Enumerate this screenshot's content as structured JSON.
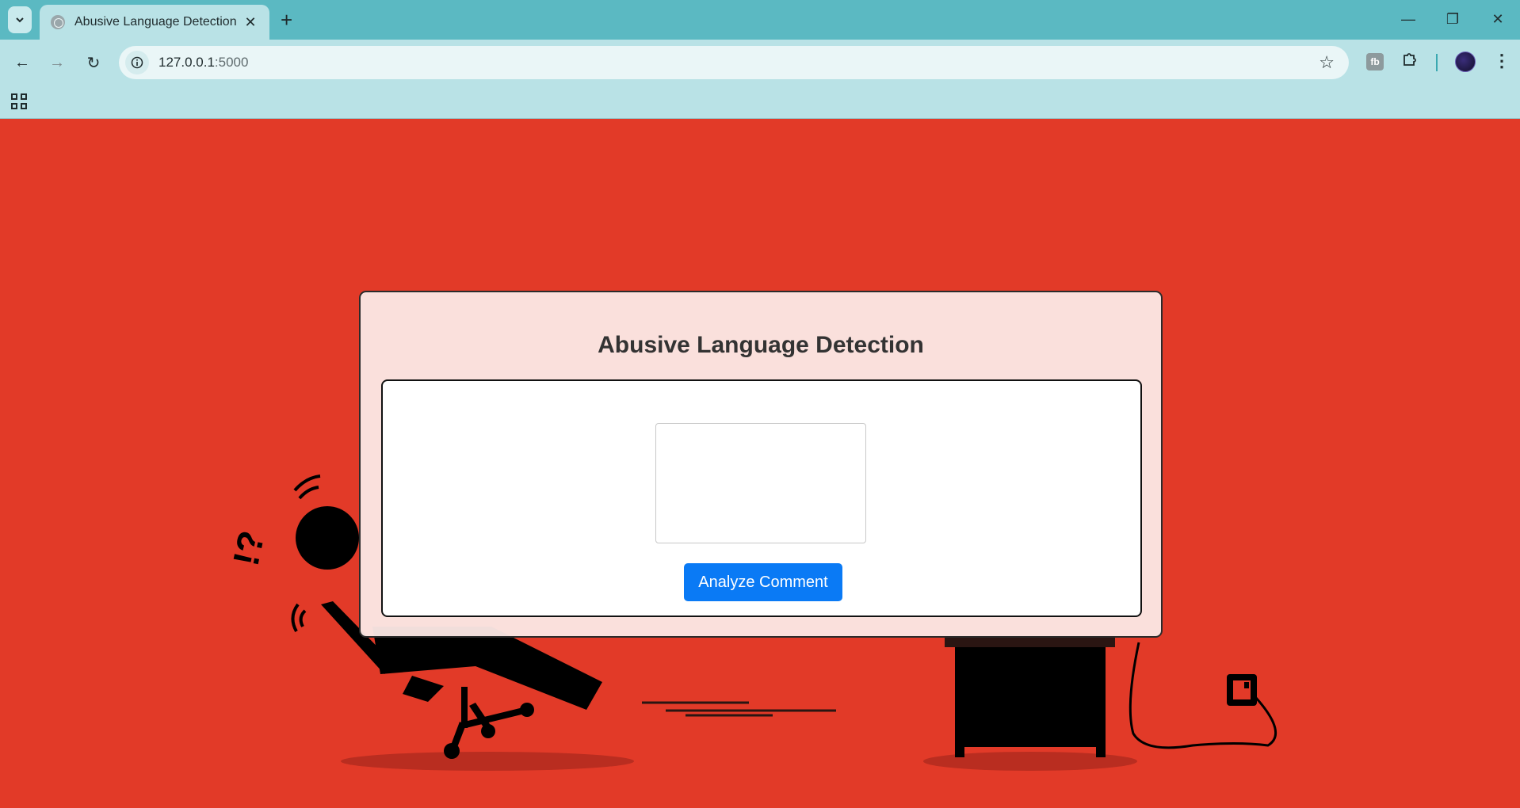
{
  "browser": {
    "tab_title": "Abusive Language Detection",
    "url_host": "127.0.0.1",
    "url_port": ":5000"
  },
  "page": {
    "background_color": "#e23a28",
    "title": "Abusive Language Detection",
    "comment_input": {
      "value": "",
      "placeholder": ""
    },
    "analyze_button_label": "Analyze Comment",
    "accent_color": "#0a7af5"
  },
  "illustration": {
    "exclaim_text": "!?"
  }
}
